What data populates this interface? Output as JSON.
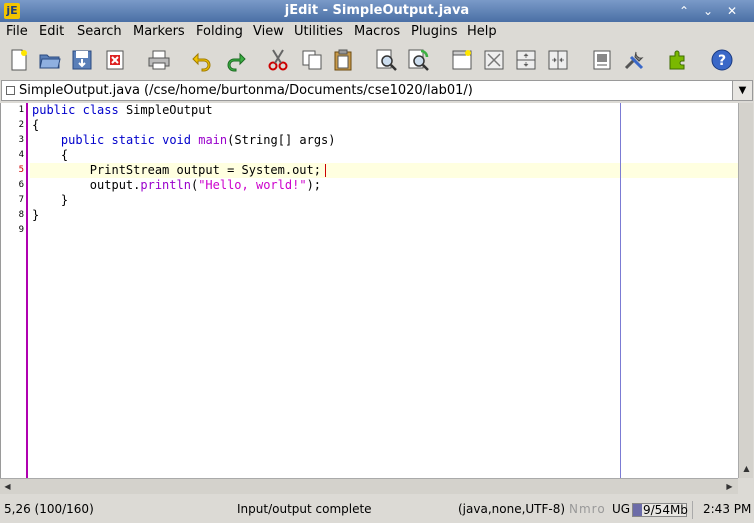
{
  "window": {
    "title": "jEdit - SimpleOutput.java",
    "app_icon": "jedit-icon",
    "controls": [
      "⌃",
      "⌄",
      "✕"
    ]
  },
  "menu": [
    "File",
    "Edit",
    "Search",
    "Markers",
    "Folding",
    "View",
    "Utilities",
    "Macros",
    "Plugins",
    "Help"
  ],
  "toolbar_icons": [
    "new-file-icon",
    "open-file-icon",
    "save-file-icon",
    "close-file-icon",
    "print-icon",
    "undo-icon",
    "redo-icon",
    "cut-icon",
    "copy-icon",
    "paste-icon",
    "find-icon",
    "find-next-icon",
    "new-view-icon",
    "unsplit-icon",
    "split-horizontal-icon",
    "split-vertical-icon",
    "buffer-options-icon",
    "global-options-icon",
    "plugin-manager-icon",
    "help-icon"
  ],
  "buffer": {
    "label": "SimpleOutput.java (/cse/home/burtonma/Documents/cse1020/lab01/)"
  },
  "editor": {
    "line_numbers": [
      "1",
      "2",
      "3",
      "4",
      "5",
      "6",
      "7",
      "8",
      "9"
    ],
    "current_line": 5,
    "lines": [
      [
        {
          "t": "public",
          "c": "kw"
        },
        {
          "t": " "
        },
        {
          "t": "class",
          "c": "kw"
        },
        {
          "t": " SimpleOutput"
        }
      ],
      [
        {
          "t": "{"
        }
      ],
      [
        {
          "t": "    "
        },
        {
          "t": "public",
          "c": "kw"
        },
        {
          "t": " "
        },
        {
          "t": "static",
          "c": "kw"
        },
        {
          "t": " "
        },
        {
          "t": "void",
          "c": "kw"
        },
        {
          "t": " "
        },
        {
          "t": "main",
          "c": "fn"
        },
        {
          "t": "(String[] args)"
        }
      ],
      [
        {
          "t": "    {"
        }
      ],
      [
        {
          "t": "        PrintStream output = System.out;"
        }
      ],
      [
        {
          "t": "        output."
        },
        {
          "t": "println",
          "c": "fn"
        },
        {
          "t": "("
        },
        {
          "t": "\"Hello, world!\"",
          "c": "str"
        },
        {
          "t": ");"
        }
      ],
      [
        {
          "t": "    }"
        }
      ],
      [
        {
          "t": "}"
        }
      ],
      [
        {
          "t": ""
        }
      ]
    ]
  },
  "status": {
    "caret": "5,26 (100/160)",
    "message": "Input/output complete",
    "mode": "(java,none,UTF-8)",
    "flags": "Nmro",
    "flags2": "UG",
    "memory": "9/54Mb",
    "memory_fraction": 0.17,
    "clock": "2:43 PM"
  }
}
